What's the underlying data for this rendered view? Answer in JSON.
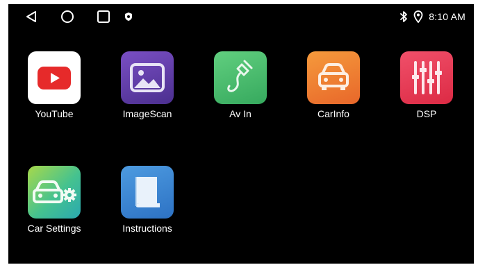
{
  "status_bar": {
    "nav": {
      "back_icon": "back-triangle-icon",
      "home_icon": "home-circle-icon",
      "recents_icon": "recents-square-icon"
    },
    "notification_icon": "shield-icon",
    "bluetooth_icon": "bluetooth-icon",
    "location_icon": "location-pin-icon",
    "time": "8:10 AM"
  },
  "apps": [
    {
      "label": "YouTube",
      "icon": "youtube-icon",
      "color": "#ffffff"
    },
    {
      "label": "ImageScan",
      "icon": "image-icon",
      "color": "#5f3ea6"
    },
    {
      "label": "Av In",
      "icon": "av-cable-icon",
      "color": "#4fbf71"
    },
    {
      "label": "CarInfo",
      "icon": "car-icon",
      "color": "#f07a2b"
    },
    {
      "label": "DSP",
      "icon": "equalizer-icon",
      "color": "#e83a4f"
    },
    {
      "label": "Car Settings",
      "icon": "car-settings-icon",
      "color": "#45c28f"
    },
    {
      "label": "Instructions",
      "icon": "book-icon",
      "color": "#2e7fd0"
    }
  ]
}
